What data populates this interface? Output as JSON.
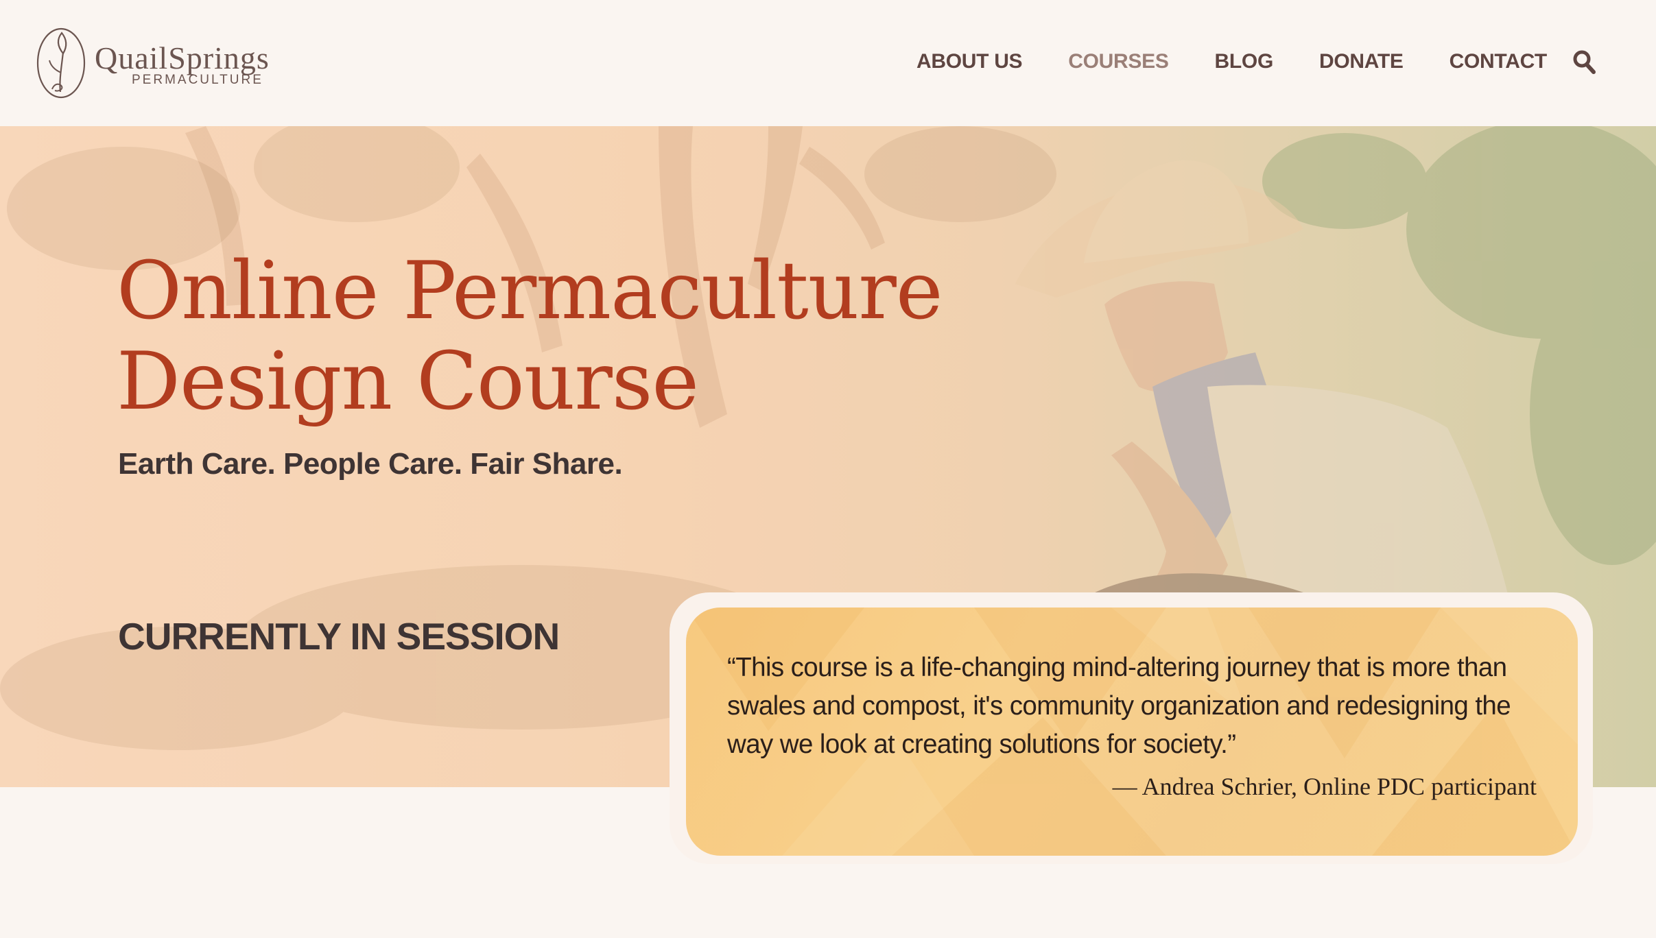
{
  "brand": {
    "name_first": "Quail",
    "name_second": "Springs",
    "subtitle": "PERMACULTURE"
  },
  "nav": {
    "items": [
      {
        "label": "ABOUT US",
        "active": false
      },
      {
        "label": "COURSES",
        "active": true
      },
      {
        "label": "BLOG",
        "active": false
      },
      {
        "label": "DONATE",
        "active": false
      },
      {
        "label": "CONTACT",
        "active": false
      }
    ],
    "search_icon": "search-icon"
  },
  "hero": {
    "title_line1": "Online Permaculture",
    "title_line2": "Design Course",
    "tagline": "Earth Care. People Care. Fair Share.",
    "session_label": "CURRENTLY IN SESSION"
  },
  "testimonial": {
    "quote": "“This course is a life-changing mind-altering journey that is more than swales and compost, it's community organization and redesigning the way we look at creating solutions for society.”",
    "author": "— Andrea Schrier, Online PDC participant"
  },
  "colors": {
    "page_bg": "#faf5f1",
    "title_red": "#b23d1f",
    "nav_text": "#5e4541",
    "nav_active": "#9a7f77",
    "quote_bg": "#f8d08c",
    "dark_text": "#3e3434"
  }
}
